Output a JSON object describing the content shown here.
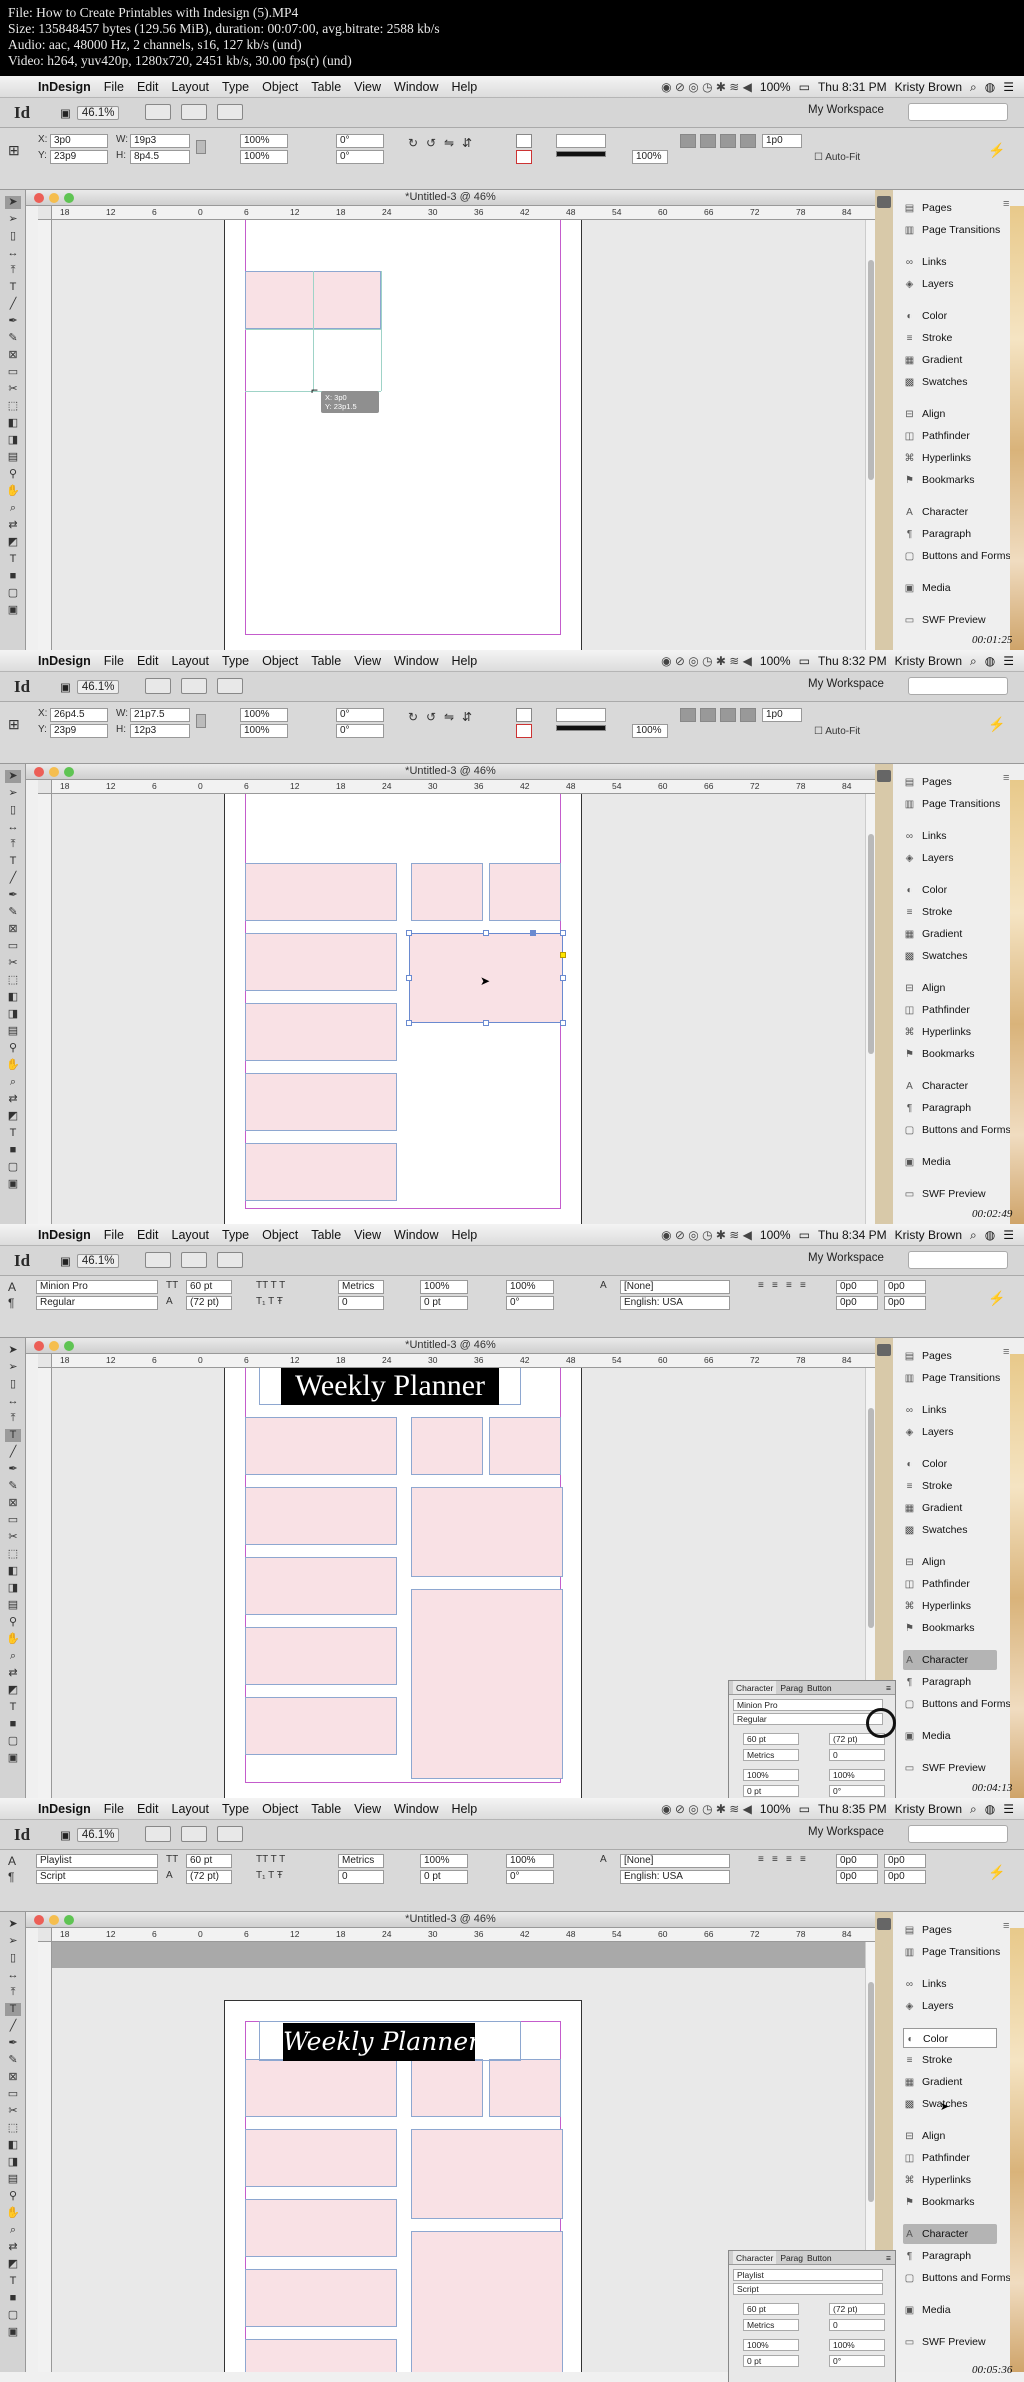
{
  "file_info": [
    "File: How to Create Printables with Indesign (5).MP4",
    "Size: 135848457 bytes (129.56 MiB), duration: 00:07:00, avg.bitrate: 2588 kb/s",
    "Audio: aac, 48000 Hz, 2 channels, s16, 127 kb/s (und)",
    "Video: h264, yuv420p, 1280x720, 2451 kb/s, 30.00 fps(r) (und)"
  ],
  "app": {
    "name": "InDesign",
    "menus": [
      "File",
      "Edit",
      "Layout",
      "Type",
      "Object",
      "Table",
      "View",
      "Window",
      "Help"
    ],
    "zoom": "46.1%",
    "workspace": "My Workspace",
    "doc_title": "*Untitled-3 @ 46%",
    "user": "Kristy Brown",
    "battery": "100%"
  },
  "ruler_ticks": [
    "18",
    "12",
    "6",
    "0",
    "6",
    "12",
    "18",
    "24",
    "30",
    "36",
    "42",
    "48",
    "54",
    "60",
    "66",
    "72",
    "78",
    "84"
  ],
  "panels": {
    "group1": [
      "Pages",
      "Page Transitions"
    ],
    "group2": [
      "Links",
      "Layers"
    ],
    "group3": [
      "Color",
      "Stroke",
      "Gradient",
      "Swatches"
    ],
    "group4": [
      "Align",
      "Pathfinder",
      "Hyperlinks",
      "Bookmarks"
    ],
    "group5": [
      "Character",
      "Paragraph",
      "Buttons and Forms"
    ],
    "group6": [
      "Media"
    ],
    "group7": [
      "SWF Preview"
    ]
  },
  "frames": [
    {
      "clock": "Thu 8:31 PM",
      "timestamp": "00:01:25",
      "x": "3p0",
      "y": "23p9",
      "w": "19p3",
      "h": "8p4.5",
      "tooltip_x": "X: 3p0",
      "tooltip_y": "Y: 23p1.5"
    },
    {
      "clock": "Thu 8:32 PM",
      "timestamp": "00:02:49",
      "x": "26p4.5",
      "y": "23p9",
      "w": "21p7.5",
      "h": "12p3"
    },
    {
      "clock": "Thu 8:34 PM",
      "timestamp": "00:04:13",
      "font": "Minion Pro",
      "style": "Regular",
      "size": "60 pt",
      "leading": "(72 pt)",
      "kerning": "Metrics",
      "language": "English: USA",
      "title": "Weekly Planner"
    },
    {
      "clock": "Thu 8:35 PM",
      "timestamp": "00:05:36",
      "font": "Playlist",
      "style": "Script",
      "size": "60 pt",
      "leading": "(72 pt)",
      "kerning": "Metrics",
      "language": "English: USA",
      "title": "Weekly Planner"
    }
  ],
  "char_panel": {
    "tabs": [
      "Character",
      "Parag",
      "Button"
    ],
    "tracking": "0",
    "scale_h": "100%",
    "scale_v": "100%",
    "baseline": "0 pt",
    "skew": "0°"
  },
  "colors": {
    "frame_fill": "#f9e1e5",
    "margin": "#c45ccc",
    "frame_stroke": "#8ea7d0",
    "title_bg": "#000000"
  }
}
